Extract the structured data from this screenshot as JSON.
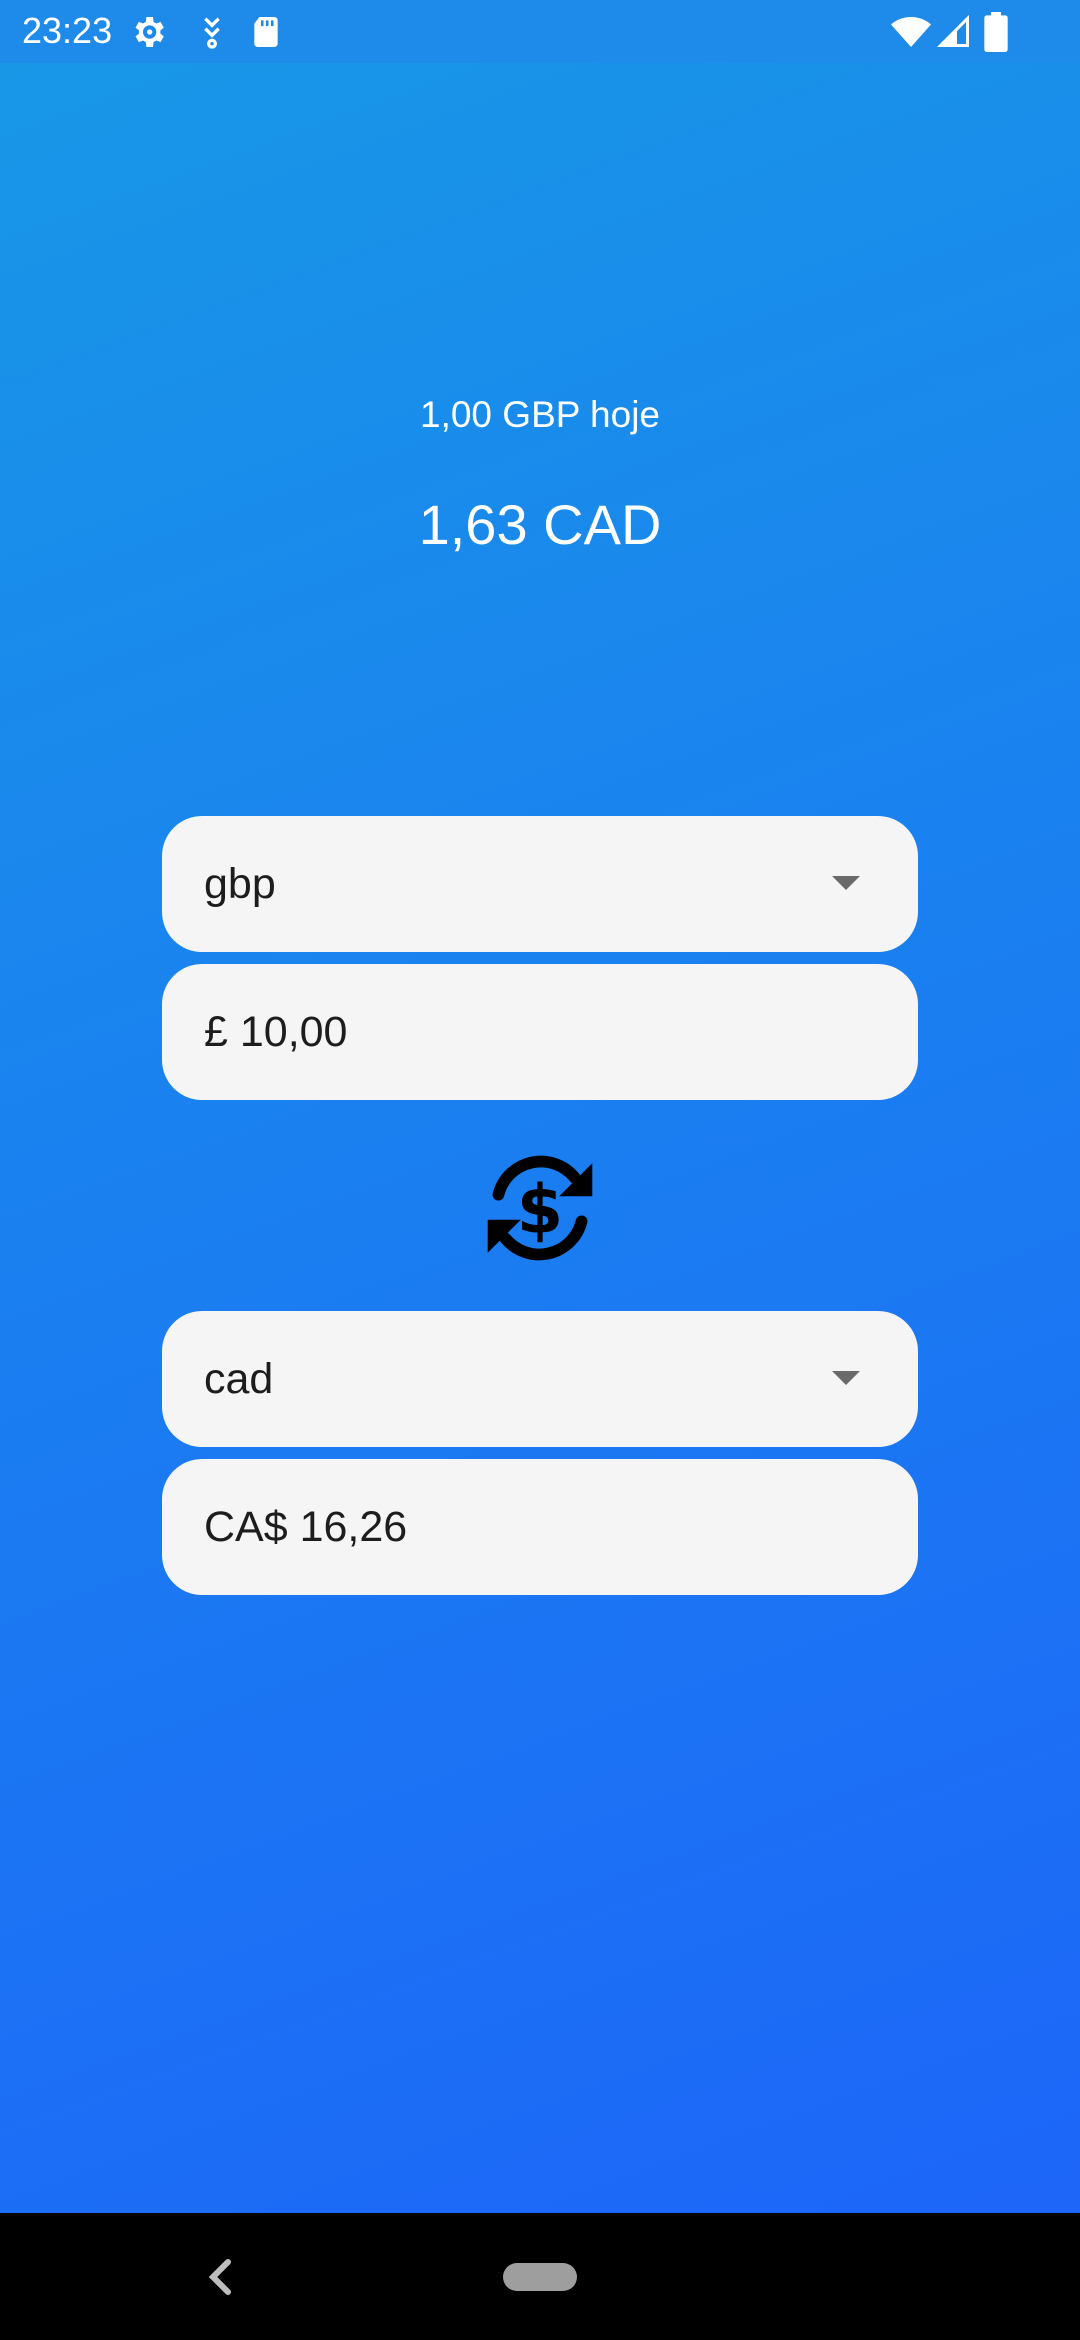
{
  "status_bar": {
    "time": "23:23",
    "left_icons": [
      "gear-icon",
      "download-icon",
      "sd-card-icon"
    ],
    "right_icons": [
      "wifi-icon",
      "signal-icon",
      "battery-icon"
    ]
  },
  "rate": {
    "caption": "1,00 GBP hoje",
    "value": "1,63 CAD"
  },
  "from": {
    "currency": "gbp",
    "amount": "£ 10,00"
  },
  "swap": {
    "icon": "currency-exchange-icon"
  },
  "to": {
    "currency": "cad",
    "amount": "CA$ 16,26"
  },
  "nav": {
    "icons": [
      "back-icon",
      "home-pill-icon"
    ]
  },
  "colors": {
    "background_top": "#1898e6",
    "background_bottom": "#1d63f9",
    "field_background": "#f5f5f5",
    "text_on_field": "#1d1d1d"
  }
}
